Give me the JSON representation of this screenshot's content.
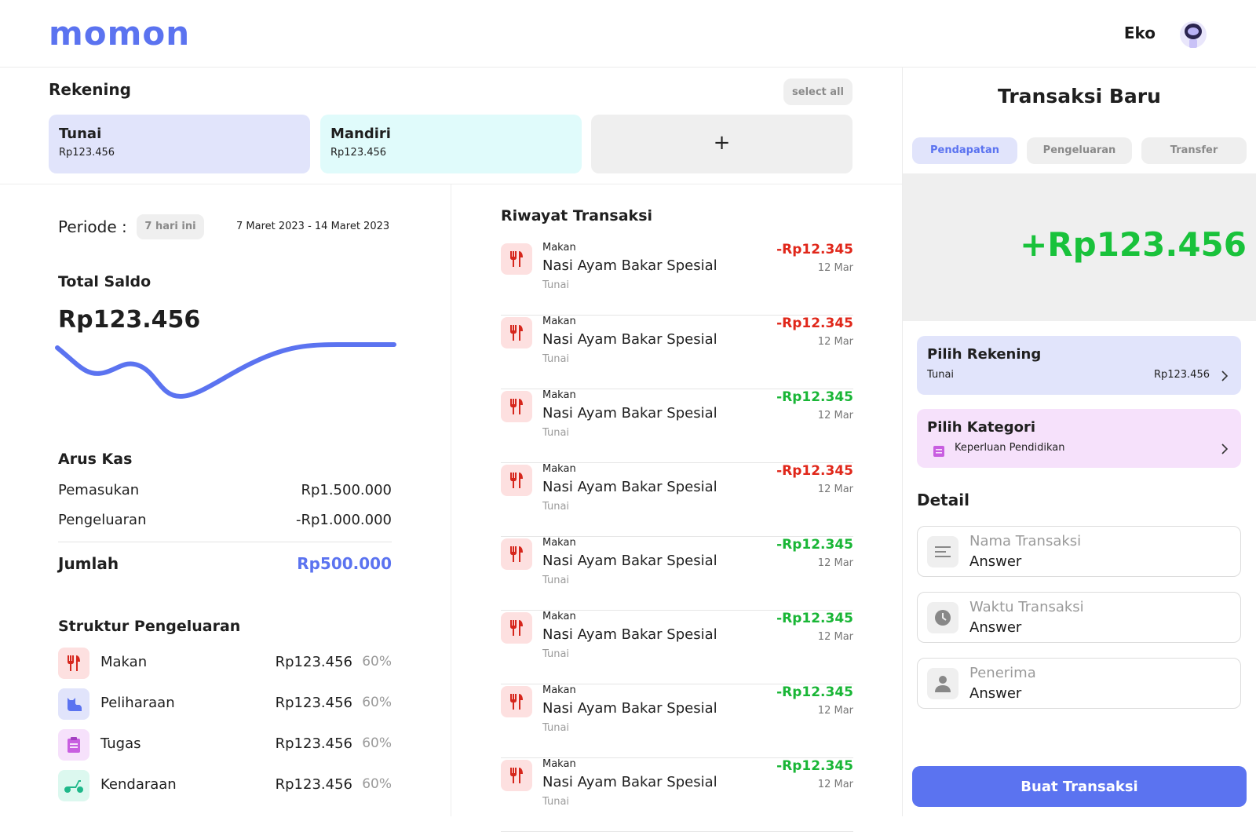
{
  "header": {
    "logo": "momon",
    "user_name": "Eko"
  },
  "rekening": {
    "title": "Rekening",
    "select_all_label": "select all",
    "accounts": [
      {
        "name": "Tunai",
        "balance": "Rp123.456",
        "color": "#e1e4fb"
      },
      {
        "name": "Mandiri",
        "balance": "Rp123.456",
        "color": "#e0fbfb"
      }
    ],
    "add_label": "+"
  },
  "periode": {
    "label": "Periode :",
    "chip": "7 hari ini",
    "range": "7 Maret 2023 - 14 Maret 2023"
  },
  "total_saldo": {
    "title": "Total Saldo",
    "value": "Rp123.456",
    "line_color": "#5b73f0"
  },
  "arus_kas": {
    "title": "Arus Kas",
    "rows": [
      {
        "label": "Pemasukan",
        "value": "Rp1.500.000"
      },
      {
        "label": "Pengeluaran",
        "value": "-Rp1.000.000"
      }
    ],
    "total_label": "Jumlah",
    "total_value": "Rp500.000"
  },
  "struktur": {
    "title": "Struktur Pengeluaran",
    "items": [
      {
        "name": "Makan",
        "amount": "Rp123.456",
        "pct": "60%",
        "icon": "utensils-icon"
      },
      {
        "name": "Peliharaan",
        "amount": "Rp123.456",
        "pct": "60%",
        "icon": "cat-icon"
      },
      {
        "name": "Tugas",
        "amount": "Rp123.456",
        "pct": "60%",
        "icon": "clipboard-icon"
      },
      {
        "name": "Kendaraan",
        "amount": "Rp123.456",
        "pct": "60%",
        "icon": "scooter-icon"
      }
    ]
  },
  "riwayat": {
    "title": "Riwayat Transaksi",
    "items": [
      {
        "category": "Makan",
        "name": "Nasi Ayam Bakar Spesial",
        "account": "Tunai",
        "amount": "-Rp12.345",
        "date": "12 Mar",
        "color": "#e0271a"
      },
      {
        "category": "Makan",
        "name": "Nasi Ayam Bakar Spesial",
        "account": "Tunai",
        "amount": "-Rp12.345",
        "date": "12 Mar",
        "color": "#e0271a"
      },
      {
        "category": "Makan",
        "name": "Nasi Ayam Bakar Spesial",
        "account": "Tunai",
        "amount": "-Rp12.345",
        "date": "12 Mar",
        "color": "#19b636"
      },
      {
        "category": "Makan",
        "name": "Nasi Ayam Bakar Spesial",
        "account": "Tunai",
        "amount": "-Rp12.345",
        "date": "12 Mar",
        "color": "#e0271a"
      },
      {
        "category": "Makan",
        "name": "Nasi Ayam Bakar Spesial",
        "account": "Tunai",
        "amount": "-Rp12.345",
        "date": "12 Mar",
        "color": "#19b636"
      },
      {
        "category": "Makan",
        "name": "Nasi Ayam Bakar Spesial",
        "account": "Tunai",
        "amount": "-Rp12.345",
        "date": "12 Mar",
        "color": "#19b636"
      },
      {
        "category": "Makan",
        "name": "Nasi Ayam Bakar Spesial",
        "account": "Tunai",
        "amount": "-Rp12.345",
        "date": "12 Mar",
        "color": "#19b636"
      },
      {
        "category": "Makan",
        "name": "Nasi Ayam Bakar Spesial",
        "account": "Tunai",
        "amount": "-Rp12.345",
        "date": "12 Mar",
        "color": "#19b636"
      }
    ]
  },
  "transaksi_baru": {
    "title": "Transaksi Baru",
    "tabs": [
      {
        "label": "Pendapatan",
        "active": true
      },
      {
        "label": "Pengeluaran",
        "active": false
      },
      {
        "label": "Transfer",
        "active": false
      }
    ],
    "amount": "+Rp123.456",
    "pilih_rekening": {
      "title": "Pilih Rekening",
      "value": "Tunai",
      "balance": "Rp123.456"
    },
    "pilih_kategori": {
      "title": "Pilih Kategori",
      "value": "Keperluan Pendidikan"
    },
    "detail_title": "Detail",
    "fields": [
      {
        "label": "Nama Transaksi",
        "placeholder": "Answer",
        "icon": "text-lines-icon"
      },
      {
        "label": "Waktu Transaksi",
        "placeholder": "Answer",
        "icon": "clock-icon"
      },
      {
        "label": "Penerima",
        "placeholder": "Answer",
        "icon": "person-icon"
      }
    ],
    "submit_label": "Buat Transaksi"
  },
  "colors": {
    "accent": "#5b73f0",
    "income": "#19c23b",
    "expense": "#e0271a"
  }
}
